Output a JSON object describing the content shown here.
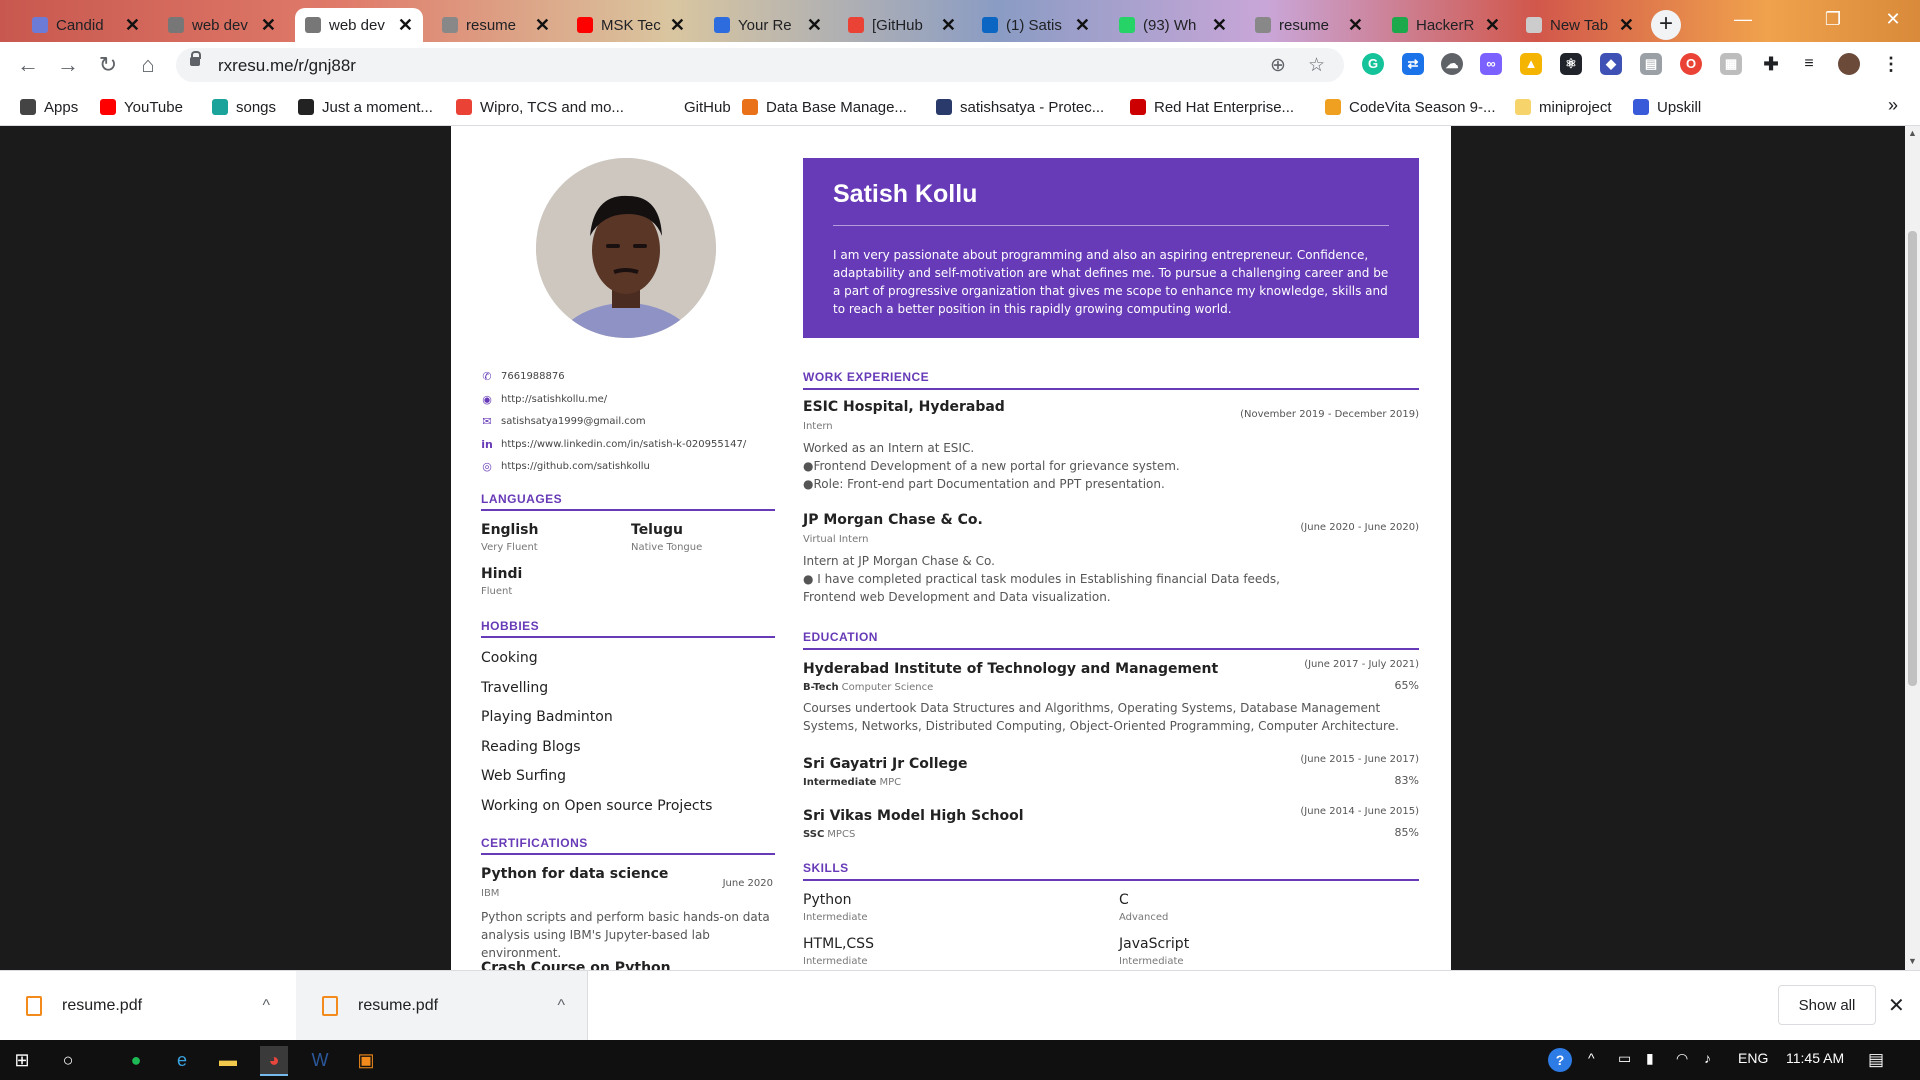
{
  "browser": {
    "tabs": [
      {
        "label": "Candid",
        "color": "#6c7bd6"
      },
      {
        "label": "web dev",
        "color": "#777777"
      },
      {
        "label": "web dev",
        "color": "#777777",
        "active": true
      },
      {
        "label": "resume",
        "color": "#888888"
      },
      {
        "label": "MSK Tec",
        "color": "#ff0000"
      },
      {
        "label": "Your Re",
        "color": "#2d6cdf"
      },
      {
        "label": "[GitHub",
        "color": "#ea4335"
      },
      {
        "label": "(1) Satis",
        "color": "#0a66c2"
      },
      {
        "label": "(93) Wh",
        "color": "#25d366"
      },
      {
        "label": "resume",
        "color": "#888888"
      },
      {
        "label": "HackerR",
        "color": "#1ba94c"
      },
      {
        "label": "New Tab",
        "color": "#cccccc"
      }
    ],
    "newtab_glyph": "+",
    "window_controls": {
      "minimize": "—",
      "restore": "❐",
      "close": "✕"
    },
    "nav": {
      "back": "←",
      "forward": "→",
      "reload": "↻",
      "home": "⌂"
    },
    "url": "rxresu.me/r/gnj88r",
    "bookmarks": [
      {
        "label": "Apps",
        "color": "#444444"
      },
      {
        "label": "YouTube",
        "color": "#ff0000"
      },
      {
        "label": "songs",
        "color": "#1aa39a"
      },
      {
        "label": "Just a moment...",
        "color": "#222222"
      },
      {
        "label": "Wipro, TCS and mo...",
        "color": "#ea4335"
      },
      {
        "label": "GitHub",
        "color": "#ffffff"
      },
      {
        "label": "Data Base Manage...",
        "color": "#e8711a"
      },
      {
        "label": "satishsatya - Protec...",
        "color": "#2a3a6a"
      },
      {
        "label": "Red Hat Enterprise...",
        "color": "#cc0000"
      },
      {
        "label": "CodeVita Season 9-...",
        "color": "#f0a020"
      },
      {
        "label": "miniproject",
        "color": "#f6d36b"
      },
      {
        "label": "Upskill",
        "color": "#3a5bd9"
      }
    ],
    "bookmarks_more": "»"
  },
  "resume": {
    "name": "Satish Kollu",
    "objective": "I am very passionate about programming and also an aspiring entrepreneur. Confidence, adaptability and self-motivation are what defines me. To pursue a challenging career and be a part of progressive organization that gives me scope to enhance my knowledge, skills and to reach a better position in this rapidly growing computing world.",
    "contacts": [
      {
        "icon": "phone-icon",
        "glyph": "✆",
        "value": "7661988876"
      },
      {
        "icon": "globe-icon",
        "glyph": "◉",
        "value": "http://satishkollu.me/"
      },
      {
        "icon": "mail-icon",
        "glyph": "✉",
        "value": "satishsatya1999@gmail.com"
      },
      {
        "icon": "linkedin-icon",
        "glyph": "in",
        "value": "https://www.linkedin.com/in/satish-k-020955147/"
      },
      {
        "icon": "github-icon",
        "glyph": "◎",
        "value": "https://github.com/satishkollu"
      }
    ],
    "languages_title": "LANGUAGES",
    "languages": [
      {
        "name": "English",
        "level": "Very Fluent"
      },
      {
        "name": "Telugu",
        "level": "Native Tongue"
      },
      {
        "name": "Hindi",
        "level": "Fluent"
      }
    ],
    "hobbies_title": "HOBBIES",
    "hobbies": [
      "Cooking",
      "Travelling",
      "Playing Badminton",
      "Reading Blogs",
      "Web Surfing",
      "Working on Open source Projects"
    ],
    "certifications_title": "CERTIFICATIONS",
    "certifications": [
      {
        "title": "Python for data science",
        "issuer": "IBM",
        "date": "June 2020",
        "desc": "Python scripts and perform basic hands-on data analysis using IBM's Jupyter-based lab environment."
      },
      {
        "title": "Crash Course on Python"
      }
    ],
    "work_title": "WORK EXPERIENCE",
    "work": [
      {
        "company": "ESIC Hospital, Hyderabad",
        "role": "Intern",
        "date": "(November 2019 - December 2019)",
        "lines": [
          "Worked as an Intern at ESIC.",
          "●Frontend Development of a new portal for grievance system.",
          "●Role: Front-end part Documentation and PPT presentation."
        ]
      },
      {
        "company": "JP Morgan Chase & Co.",
        "role": "Virtual Intern",
        "date": "(June 2020 - June 2020)",
        "lines": [
          "Intern at JP Morgan Chase & Co.",
          "● I have completed practical task modules in Establishing financial Data feeds,",
          "Frontend web Development and Data visualization."
        ]
      }
    ],
    "education_title": "EDUCATION",
    "education": [
      {
        "school": "Hyderabad Institute of Technology and Management",
        "degree": "B-Tech",
        "field": "Computer Science",
        "date": "(June 2017 - July 2021)",
        "score": "65%",
        "desc": "Courses undertook Data Structures and Algorithms, Operating Systems, Database Management Systems, Networks, Distributed Computing, Object-Oriented Programming, Computer Architecture."
      },
      {
        "school": "Sri Gayatri Jr College",
        "degree": "Intermediate",
        "field": "MPC",
        "date": "(June 2015 - June 2017)",
        "score": "83%"
      },
      {
        "school": "Sri Vikas Model High School",
        "degree": "SSC",
        "field": "MPCS",
        "date": "(June 2014 - June 2015)",
        "score": "85%"
      }
    ],
    "skills_title": "SKILLS",
    "skills": [
      {
        "name": "Python",
        "level": "Intermediate"
      },
      {
        "name": "C",
        "level": "Advanced"
      },
      {
        "name": "HTML,CSS",
        "level": "Intermediate"
      },
      {
        "name": "JavaScript",
        "level": "Intermediate"
      }
    ]
  },
  "downloads": {
    "items": [
      {
        "name": "resume.pdf"
      },
      {
        "name": "resume.pdf"
      }
    ],
    "chevron": "^",
    "show_all": "Show all",
    "close": "✕"
  },
  "taskbar": {
    "time": "11:45 AM",
    "language": "ENG",
    "apps": [
      {
        "icon": "windows-start-icon",
        "glyph": "⊞",
        "color": "#ffffff"
      },
      {
        "icon": "search-circle-icon",
        "glyph": "○",
        "color": "#ffffff"
      },
      {
        "icon": "spotify-icon",
        "glyph": "●",
        "color": "#1db954"
      },
      {
        "icon": "edge-icon",
        "glyph": "e",
        "color": "#3ba3e0"
      },
      {
        "icon": "file-explorer-icon",
        "glyph": "▬",
        "color": "#f2c94c"
      },
      {
        "icon": "chrome-icon",
        "glyph": "◕",
        "color": "#e8453c"
      },
      {
        "icon": "word-icon",
        "glyph": "W",
        "color": "#2b579a"
      },
      {
        "icon": "pdf-viewer-icon",
        "glyph": "▣",
        "color": "#f28b1c"
      }
    ]
  }
}
